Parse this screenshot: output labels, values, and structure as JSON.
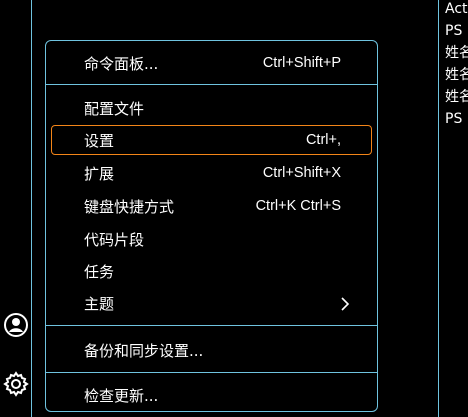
{
  "activity_bar": {
    "accounts_icon": "account-icon",
    "manage_icon": "gear-icon"
  },
  "menu": {
    "items": [
      {
        "label": "命令面板...",
        "shortcut": "Ctrl+Shift+P"
      },
      {
        "label": "配置文件",
        "shortcut": ""
      },
      {
        "label": "设置",
        "shortcut": "Ctrl+,"
      },
      {
        "label": "扩展",
        "shortcut": "Ctrl+Shift+X"
      },
      {
        "label": "键盘快捷方式",
        "shortcut": "Ctrl+K Ctrl+S"
      },
      {
        "label": "代码片段",
        "shortcut": ""
      },
      {
        "label": "任务",
        "shortcut": ""
      },
      {
        "label": "主题",
        "shortcut": ""
      },
      {
        "label": "备份和同步设置...",
        "shortcut": ""
      },
      {
        "label": "检查更新...",
        "shortcut": ""
      }
    ]
  },
  "right_panel": {
    "lines": [
      "Act",
      "PS",
      "姓名",
      "姓名",
      "姓名",
      "PS"
    ]
  },
  "colors": {
    "border": "#6fc3df",
    "focus": "#f38518",
    "background": "#000000",
    "text": "#ffffff"
  }
}
